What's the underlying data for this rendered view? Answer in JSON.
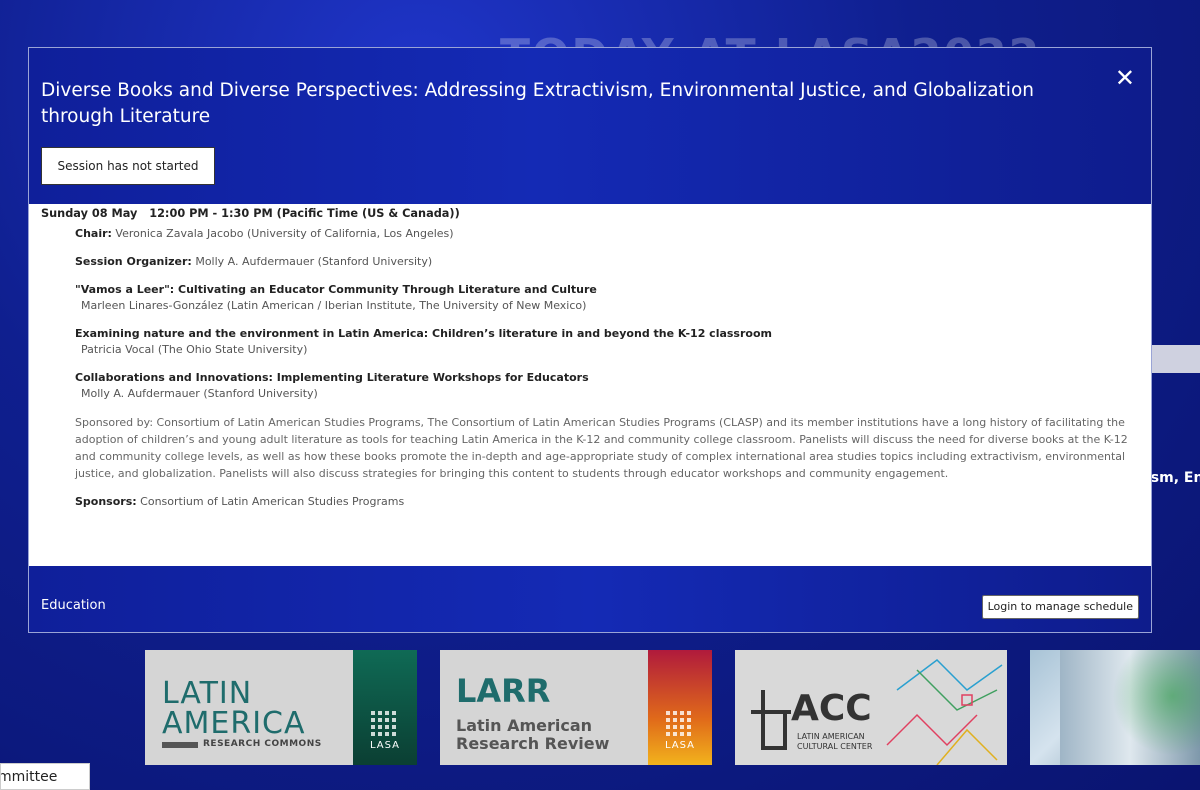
{
  "background": {
    "heading": "TODAY AT LASA2022",
    "snippet": "ism, Env",
    "footer_fragment": "mmittee"
  },
  "banners": [
    {
      "line1": "LATIN",
      "line2": "AMERICA",
      "sub": "RESEARCH COMMONS",
      "brand": "LASA"
    },
    {
      "line1": "LARR",
      "line2": "Latin American",
      "line3": "Research Review",
      "brand": "LASA"
    },
    {
      "line1": "ACC",
      "sub1": "LATIN AMERICAN",
      "sub2": "CULTURAL CENTER"
    }
  ],
  "modal": {
    "title": "Diverse Books and Diverse Perspectives: Addressing Extractivism, Environmental Justice, and Globalization through Literature",
    "close_symbol": "✕",
    "status": "Session has not started",
    "date_time": "Sunday 08 May   12:00 PM - 1:30 PM (Pacific Time (US & Canada))",
    "chair_label": "Chair:",
    "chair": "Veronica Zavala Jacobo (University of California, Los Angeles)",
    "organizer_label": "Session Organizer:",
    "organizer": "Molly A. Aufdermauer (Stanford University)",
    "papers": [
      {
        "title": "\"Vamos a Leer\": Cultivating an Educator Community Through Literature and Culture",
        "author": "Marleen Linares-González (Latin American / Iberian Institute, The University of New Mexico)"
      },
      {
        "title": "Examining nature and the environment in Latin America: Children’s literature in and beyond the K-12 classroom",
        "author": "Patricia Vocal (The Ohio State University)"
      },
      {
        "title": "Collaborations and Innovations: Implementing Literature Workshops for Educators",
        "author": "Molly A. Aufdermauer (Stanford University)"
      }
    ],
    "description": "Sponsored by: Consortium of Latin American Studies Programs, The Consortium of Latin American Studies Programs (CLASP) and its member institutions have a long history of facilitating the adoption of children’s and young adult literature as tools for teaching Latin America in the K-12 and community college classroom. Panelists will discuss the need for diverse books at the K-12 and community college levels, as well as how these books promote the in-depth and age-appropriate study of complex international area studies topics including extractivism, environmental justice, and globalization. Panelists will also discuss strategies for bringing this content to students through educator workshops and community engagement.",
    "sponsors_label": "Sponsors:",
    "sponsors": "Consortium of Latin American Studies Programs",
    "track": "Education",
    "login_button": "Login to manage schedule"
  }
}
